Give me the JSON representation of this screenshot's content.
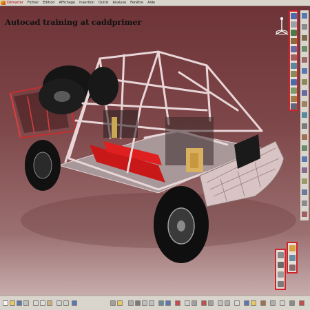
{
  "app": {
    "menu": [
      {
        "label": "Démarrer",
        "active": true
      },
      {
        "label": "Fichier",
        "active": false
      },
      {
        "label": "Edition",
        "active": false
      },
      {
        "label": "Affichage",
        "active": false
      },
      {
        "label": "Insertion",
        "active": false
      },
      {
        "label": "Outils",
        "active": false
      },
      {
        "label": "Analyse",
        "active": false
      },
      {
        "label": "Fenêtre",
        "active": false
      },
      {
        "label": "Aide",
        "active": false
      }
    ]
  },
  "overlay": {
    "watermark": "Autocad training at caddprimer"
  },
  "toolbars": {
    "right_main": {
      "icon": "workbench-tools"
    },
    "right_bottom": {
      "icon": "analysis-tools"
    },
    "bottom": {
      "icon": "view-tools"
    }
  },
  "colors": {
    "accent_red": "#d0242a",
    "background_top": "#6e3438",
    "background_bottom": "#c8aeae",
    "frame_tube": "#e8d6d8",
    "highlight_red": "#c81818",
    "tire": "#161616"
  }
}
